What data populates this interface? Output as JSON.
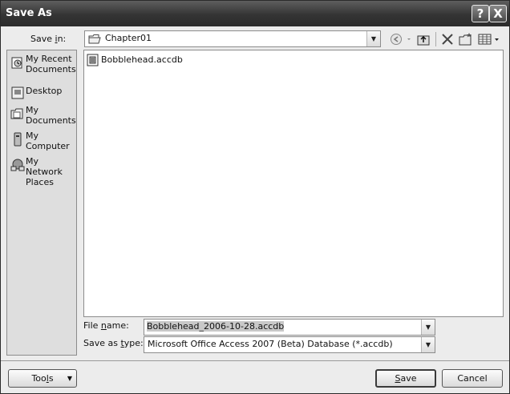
{
  "window": {
    "title": "Save As",
    "help_glyph": "?",
    "close_glyph": "X"
  },
  "toolbar": {
    "save_in_label_pre": "Save ",
    "save_in_label_u": "i",
    "save_in_label_post": "n:",
    "save_in_value": "Chapter01",
    "icons": [
      "back-icon",
      "up-folder-icon",
      "delete-icon",
      "new-folder-icon",
      "views-icon"
    ]
  },
  "places": [
    {
      "label": "My Recent Documents",
      "icon": "recent-documents-icon"
    },
    {
      "label": "Desktop",
      "icon": "desktop-icon"
    },
    {
      "label": "My Documents",
      "icon": "my-documents-icon"
    },
    {
      "label": "My Computer",
      "icon": "my-computer-icon"
    },
    {
      "label": "My Network Places",
      "icon": "network-places-icon"
    }
  ],
  "files": [
    {
      "name": "Bobblehead.accdb",
      "icon": "access-database-icon"
    }
  ],
  "form": {
    "file_name_label_pre": "File ",
    "file_name_label_u": "n",
    "file_name_label_post": "ame:",
    "file_name_value": "Bobblehead_2006-10-28.accdb",
    "type_label_pre": "Save as ",
    "type_label_u": "t",
    "type_label_post": "ype:",
    "type_value": "Microsoft Office Access 2007 (Beta) Database (*.accdb)"
  },
  "buttons": {
    "tools_pre": "Too",
    "tools_u": "l",
    "tools_post": "s",
    "save_u": "S",
    "save_post": "ave",
    "cancel": "Cancel"
  }
}
